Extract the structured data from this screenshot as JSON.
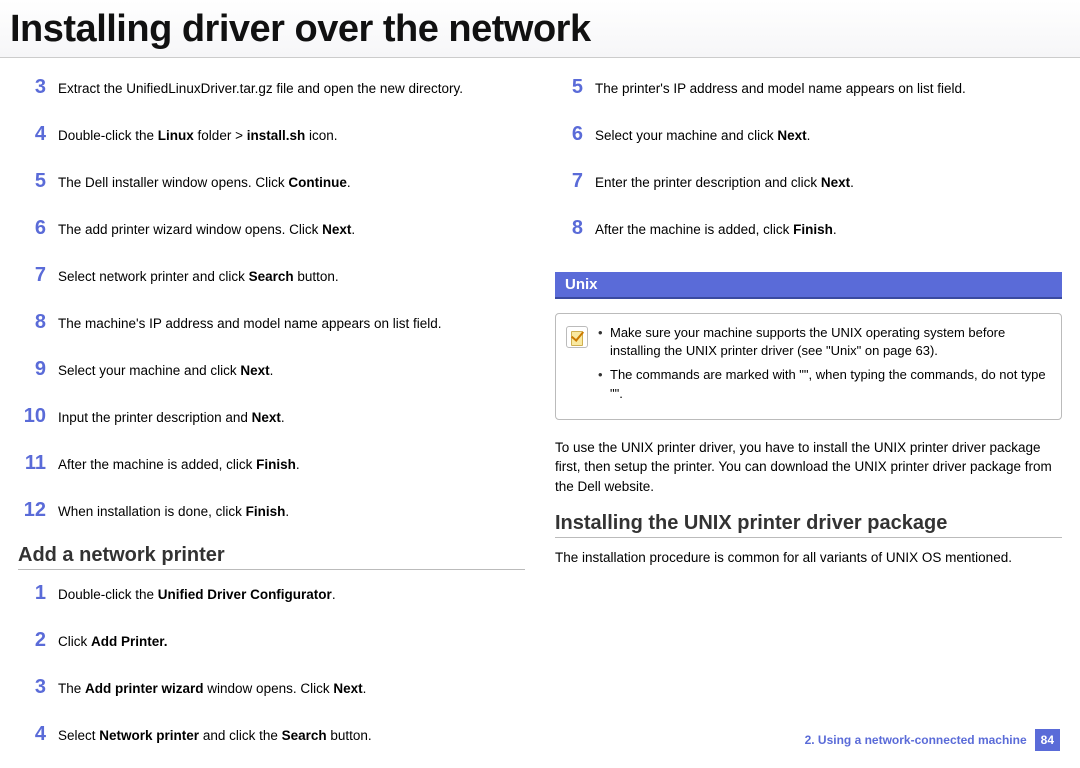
{
  "title": "Installing driver over the network",
  "left": {
    "steps1": [
      {
        "n": "3",
        "html": "Extract the UnifiedLinuxDriver.tar.gz file and open the new directory."
      },
      {
        "n": "4",
        "html": "Double-click the <b>Linux</b> folder > <b>install.sh</b> icon."
      },
      {
        "n": "5",
        "html": "The Dell installer window opens. Click <b>Continue</b>."
      },
      {
        "n": "6",
        "html": "The add printer wizard window opens. Click <b>Next</b>."
      },
      {
        "n": "7",
        "html": "Select network printer and click <b>Search</b> button."
      },
      {
        "n": "8",
        "html": "The machine's IP address and model name appears on list field."
      },
      {
        "n": "9",
        "html": "Select your machine and click <b>Next</b>."
      },
      {
        "n": "10",
        "html": "Input the printer description and <b>Next</b>."
      },
      {
        "n": "11",
        "html": "After the machine is added, click <b>Finish</b>."
      },
      {
        "n": "12",
        "html": "When installation is done, click <b>Finish</b>."
      }
    ],
    "subhead": "Add a network printer",
    "steps2": [
      {
        "n": "1",
        "html": "Double-click the <b>Unified Driver Configurator</b>."
      },
      {
        "n": "2",
        "html": "Click <b>Add Printer.</b>"
      },
      {
        "n": "3",
        "html": "The <b>Add printer wizard</b> window opens. Click <b>Next</b>."
      },
      {
        "n": "4",
        "html": "Select <b>Network printer</b> and click the <b>Search</b> button."
      }
    ]
  },
  "right": {
    "stepsTop": [
      {
        "n": "5",
        "html": "The printer's IP address and model name appears on list field."
      },
      {
        "n": "6",
        "html": "Select your machine and click <b>Next</b>."
      },
      {
        "n": "7",
        "html": "Enter the printer description and click <b>Next</b>."
      },
      {
        "n": "8",
        "html": "After the machine is added, click <b>Finish</b>."
      }
    ],
    "banner": "Unix",
    "notes": [
      "Make sure your machine supports the UNIX operating system before installing the UNIX printer driver (see \"Unix\" on page 63).",
      "The commands are marked with \"\", when typing the commands, do not type \"\"."
    ],
    "para1": "To use the UNIX printer driver, you have to install the UNIX printer driver package first, then setup the printer. You can download the UNIX printer driver package from the Dell website.",
    "subhead": "Installing the UNIX printer driver package",
    "para2": "The installation procedure is common for all variants of UNIX OS mentioned."
  },
  "footer": {
    "chapter": "2.  Using a network-connected machine",
    "page": "84"
  }
}
